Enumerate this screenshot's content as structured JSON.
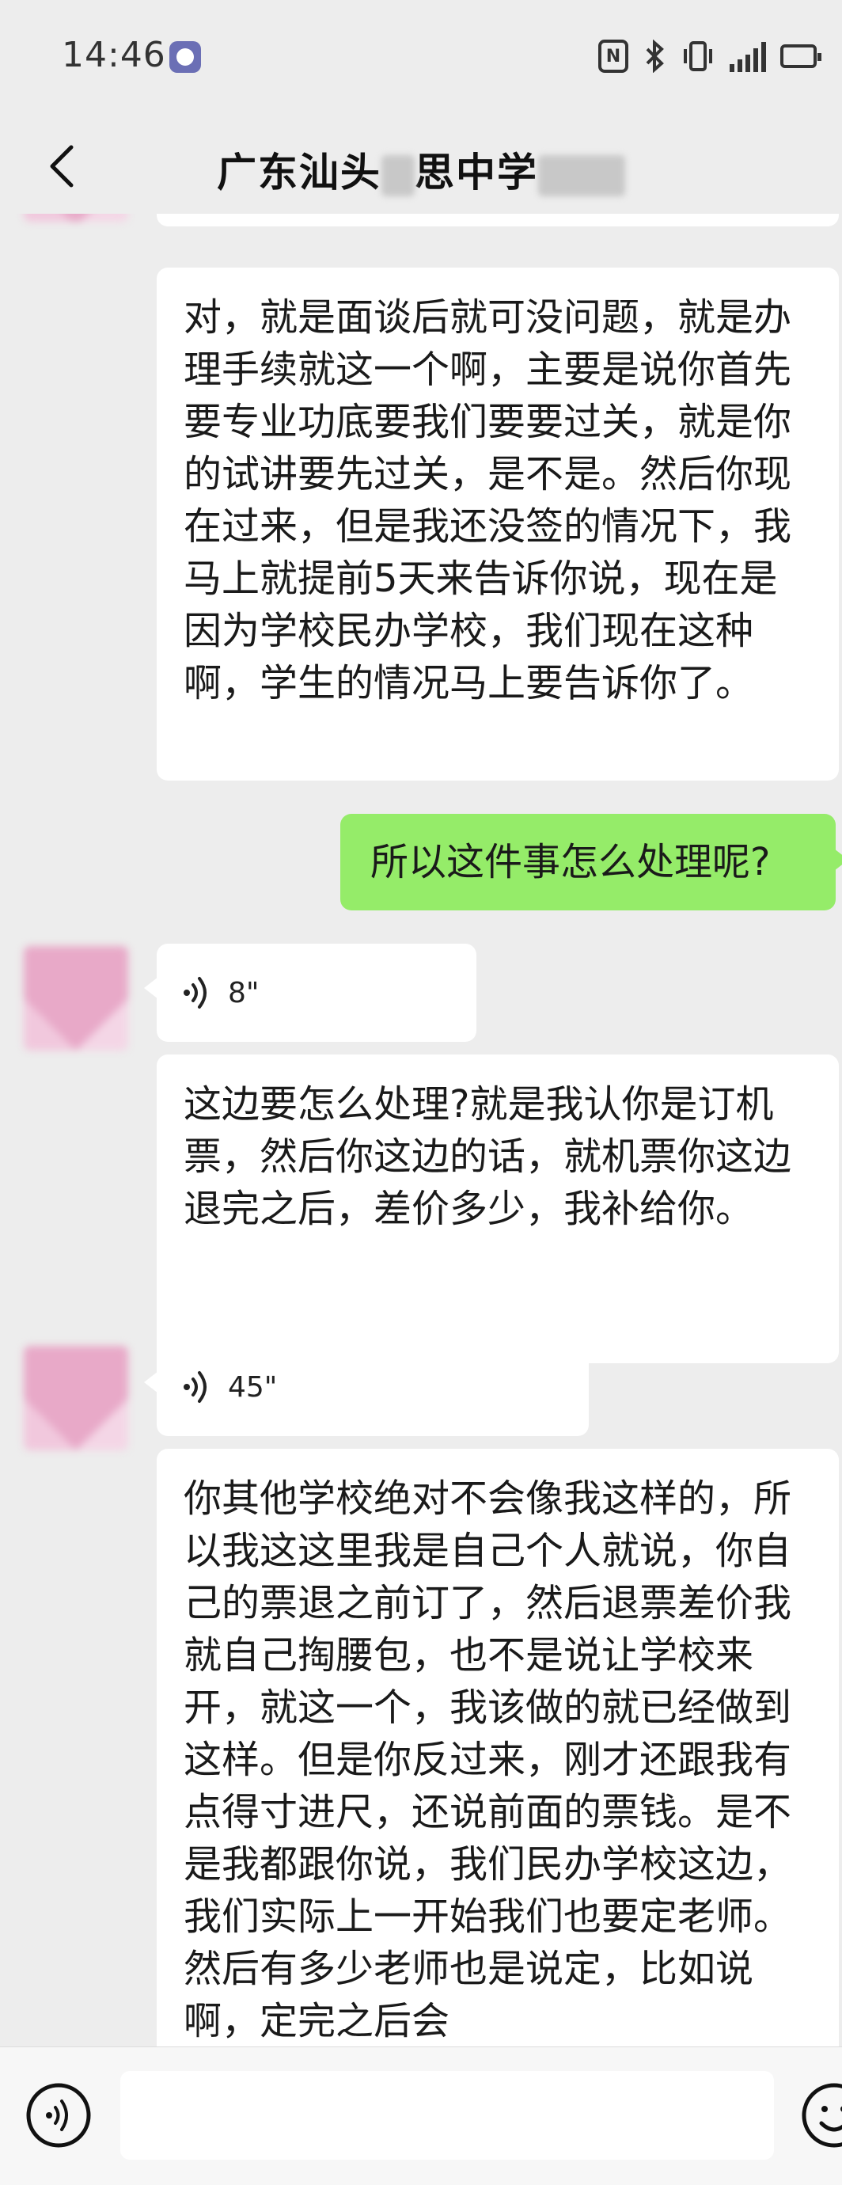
{
  "status_bar": {
    "time": "14:46",
    "app_icon": "bear-app-icon",
    "nfc_label": "N",
    "icons": [
      "nfc-icon",
      "bluetooth-icon",
      "vibrate-icon",
      "signal-icon",
      "battery-icon"
    ]
  },
  "header": {
    "title_prefix": "广东汕头",
    "title_middle": "思中学",
    "back_icon": "chevron-left-icon"
  },
  "messages": [
    {
      "sender": "other",
      "type": "text",
      "text": "对，就是面谈后就可没问题，就是办理手续就这一个啊，主要是说你首先要专业功底要我们要要过关，就是你的试讲要先过关，是不是。然后你现在过来，但是我还没签的情况下，我马上就提前5天来告诉你说，现在是因为学校民办学校，我们现在这种啊，学生的情况马上要告诉你了。"
    },
    {
      "sender": "self",
      "type": "text",
      "text": "所以这件事怎么处理呢?"
    },
    {
      "sender": "other",
      "type": "voice",
      "duration": "8\""
    },
    {
      "sender": "other",
      "type": "text",
      "text": "这边要怎么处理?就是我认你是订机票，然后你这边的话，就机票你这边退完之后，差价多少，我补给你。"
    },
    {
      "sender": "other",
      "type": "voice",
      "duration": "45\""
    },
    {
      "sender": "other",
      "type": "text",
      "text": "你其他学校绝对不会像我这样的，所以我这这里我是自己个人就说，你自己的票退之前订了，然后退票差价我就自己掏腰包，也不是说让学校来开，就这一个，我该做的就已经做到这样。但是你反过来，刚才还跟我有点得寸进尺，还说前面的票钱。是不是我都跟你说，我们民办学校这边，我们实际上一开始我们也要定老师。然后有多少老师也是说定，比如说啊，定完之后会"
    }
  ],
  "input_bar": {
    "voice_icon": "voice-mode-icon",
    "emoji_icon": "emoji-icon",
    "placeholder": ""
  },
  "colors": {
    "background": "#ededed",
    "self_bubble": "#95ec69",
    "other_bubble": "#ffffff"
  }
}
